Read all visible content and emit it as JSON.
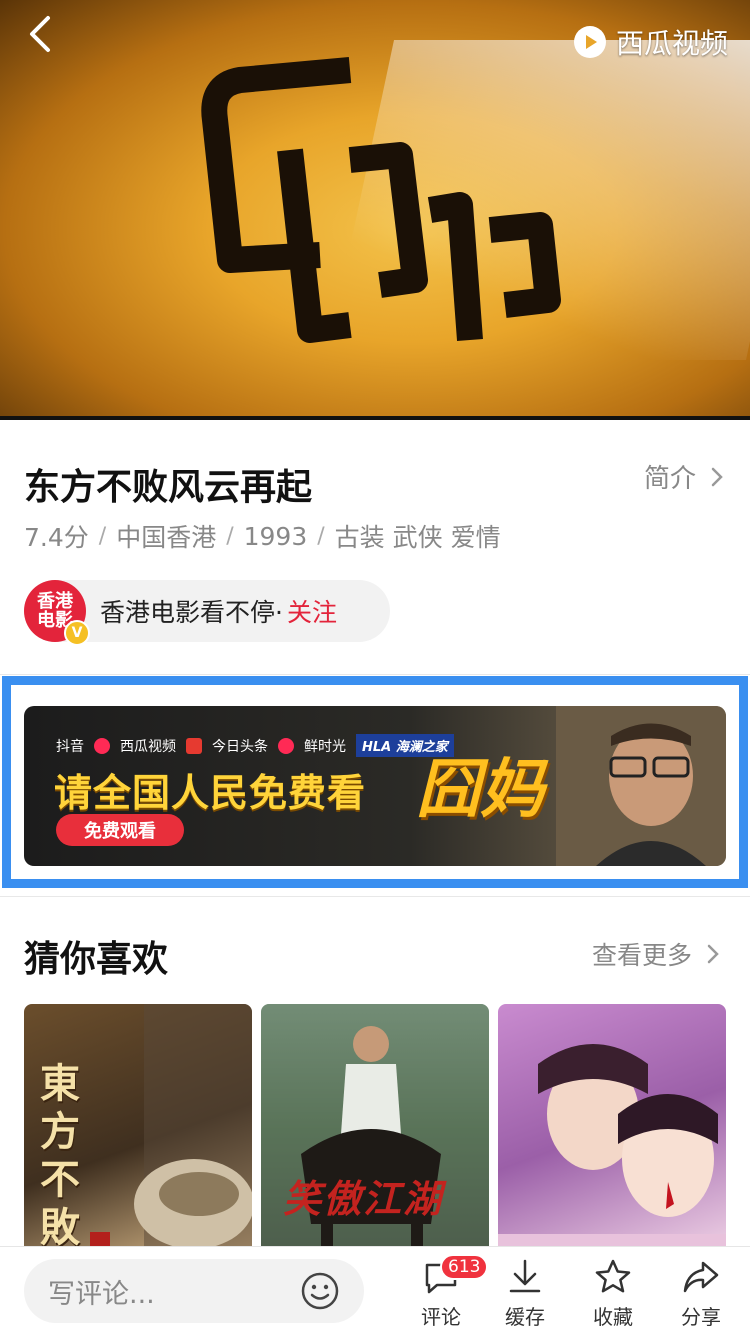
{
  "player": {
    "brand_label": "西瓜视频"
  },
  "movie": {
    "title": "东方不败风云再起",
    "intro_label": "简介",
    "score": "7.4分",
    "region": "中国香港",
    "year": "1993",
    "genres": "古装 武侠 爱情",
    "separator": "/"
  },
  "channel": {
    "avatar_text": "香港电影",
    "name": "香港电影看不停·",
    "follow_label": "关注",
    "verified_mark": "V"
  },
  "banner": {
    "partners": [
      "抖音",
      "西瓜视频",
      "今日头条",
      "鲜时光"
    ],
    "partner_hla": "HLA 海澜之家",
    "headline": "请全国人民免费看",
    "movie_name": "囧妈",
    "button_label": "免费观看"
  },
  "recommend": {
    "title": "猜你喜欢",
    "more_label": "查看更多",
    "cards": [
      {
        "art_text": "東方不敗"
      },
      {
        "art_text": "笑傲江湖"
      },
      {
        "art_text": ""
      }
    ]
  },
  "bottom_bar": {
    "comment_placeholder": "写评论...",
    "actions": [
      {
        "label": "评论",
        "icon": "comment-icon"
      },
      {
        "label": "缓存",
        "icon": "download-icon"
      },
      {
        "label": "收藏",
        "icon": "star-icon"
      },
      {
        "label": "分享",
        "icon": "share-icon"
      }
    ],
    "comment_count": "613"
  },
  "colors": {
    "accent_red": "#e3243b",
    "highlight_blue": "#3a8ff0",
    "text_gray": "#888888"
  }
}
